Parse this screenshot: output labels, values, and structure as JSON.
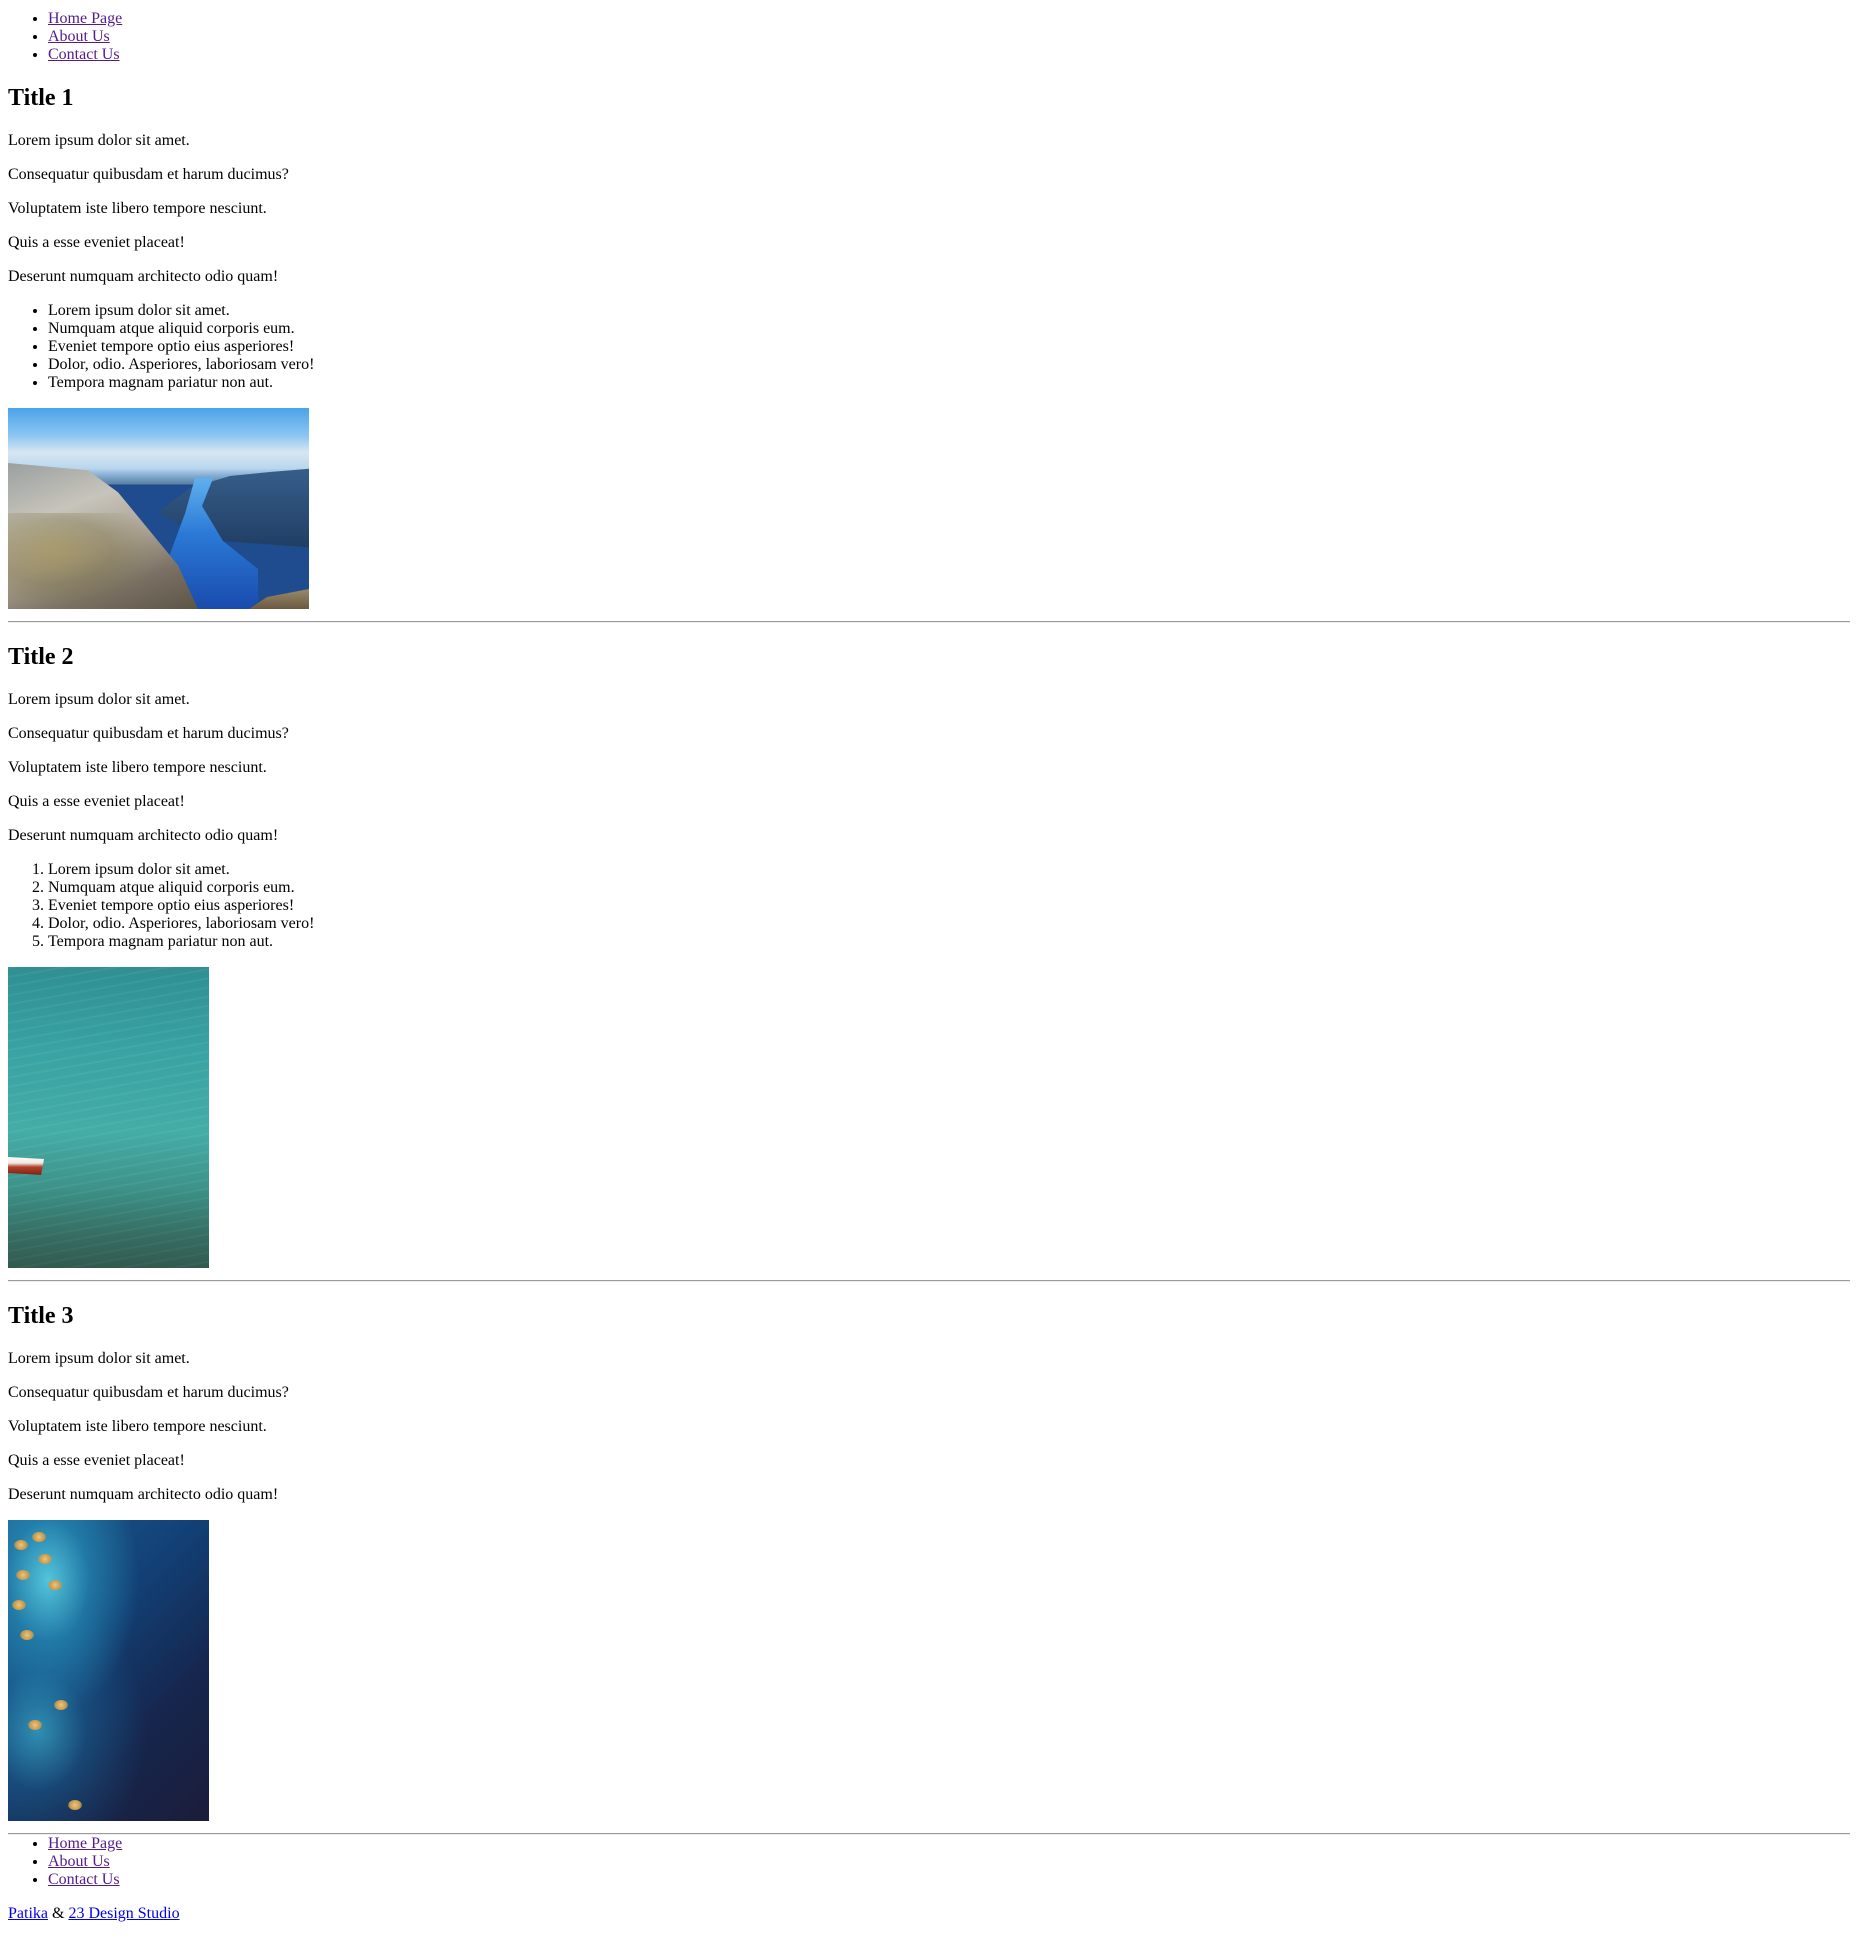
{
  "nav": {
    "items": [
      {
        "label": "Home Page"
      },
      {
        "label": "About Us"
      },
      {
        "label": "Contact Us"
      }
    ]
  },
  "sections": [
    {
      "title": "Title 1",
      "paragraphs": [
        "Lorem ipsum dolor sit amet.",
        "Consequatur quibusdam et harum ducimus?",
        "Voluptatem iste libero tempore nesciunt.",
        "Quis a esse eveniet placeat!",
        "Deserunt numquam architecto odio quam!"
      ],
      "list_type": "unordered",
      "list": [
        "Lorem ipsum dolor sit amet.",
        "Numquam atque aliquid corporis eum.",
        "Eveniet tempore optio eius asperiores!",
        "Dolor, odio. Asperiores, laboriosam vero!",
        "Tempora magnam pariatur non aut."
      ]
    },
    {
      "title": "Title 2",
      "paragraphs": [
        "Lorem ipsum dolor sit amet.",
        "Consequatur quibusdam et harum ducimus?",
        "Voluptatem iste libero tempore nesciunt.",
        "Quis a esse eveniet placeat!",
        "Deserunt numquam architecto odio quam!"
      ],
      "list_type": "ordered",
      "list": [
        "Lorem ipsum dolor sit amet.",
        "Numquam atque aliquid corporis eum.",
        "Eveniet tempore optio eius asperiores!",
        "Dolor, odio. Asperiores, laboriosam vero!",
        "Tempora magnam pariatur non aut."
      ]
    },
    {
      "title": "Title 3",
      "paragraphs": [
        "Lorem ipsum dolor sit amet.",
        "Consequatur quibusdam et harum ducimus?",
        "Voluptatem iste libero tempore nesciunt.",
        "Quis a esse eveniet placeat!",
        "Deserunt numquam architecto odio quam!"
      ]
    }
  ],
  "footer": {
    "nav": [
      {
        "label": "Home Page"
      },
      {
        "label": "About Us"
      },
      {
        "label": "Contact Us"
      }
    ],
    "credit_link_1": "Patika",
    "credit_separator": "&",
    "credit_link_2": "23 Design Studio"
  },
  "colors": {
    "link": "#0000ee",
    "link_visited": "#551a8b",
    "rule": "#9a9a9a"
  }
}
